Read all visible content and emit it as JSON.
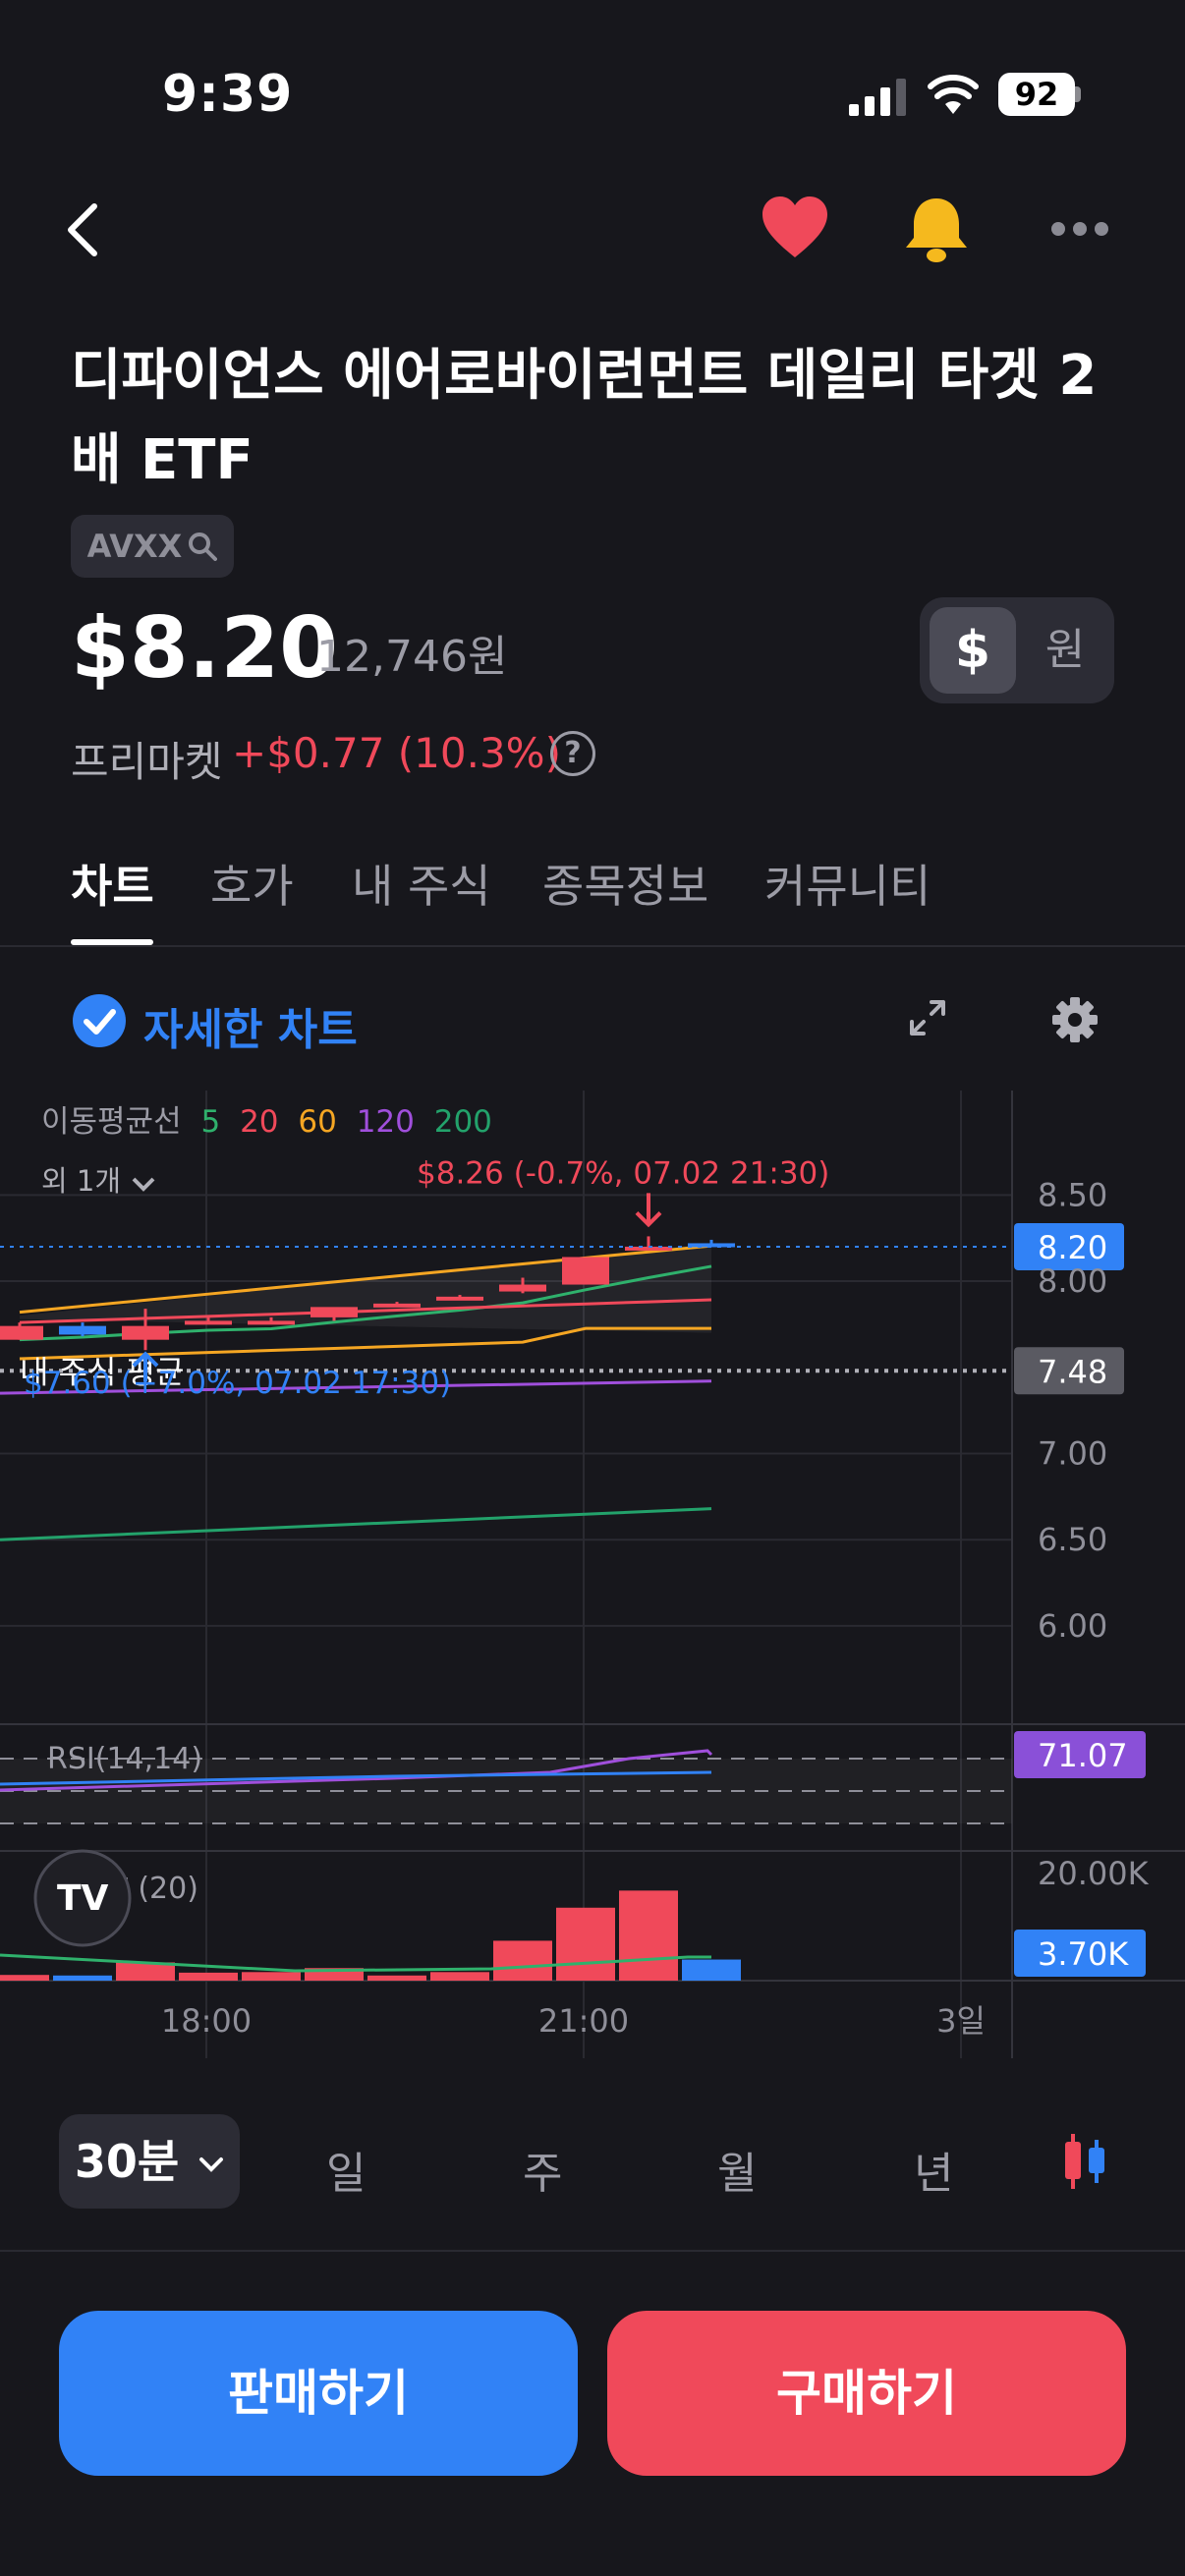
{
  "status": {
    "time": "9:39",
    "battery": "92"
  },
  "stock": {
    "title": "디파이언스 에어로바이런먼트 데일리 타겟 2배 ETF",
    "ticker": "AVXX",
    "price": "$8.20",
    "price_krw": "12,746원",
    "currency_usd": "$",
    "currency_krw": "원",
    "premarket_label": "프리마켓",
    "premarket_change": "+$0.77 (10.3%)",
    "help": "?"
  },
  "tabs": [
    {
      "label": "차트",
      "active": true
    },
    {
      "label": "호가"
    },
    {
      "label": "내 주식"
    },
    {
      "label": "종목정보"
    },
    {
      "label": "커뮤니티"
    }
  ],
  "chart_options": {
    "detail_chart": "자세한 차트"
  },
  "chart_data": {
    "type": "candlestick",
    "interval": "30분",
    "ma_label": "이동평균선",
    "ma_periods": [
      {
        "label": "5",
        "color": "#2fb16c"
      },
      {
        "label": "20",
        "color": "#f0495a"
      },
      {
        "label": "60",
        "color": "#f5a623"
      },
      {
        "label": "120",
        "color": "#a04fdc"
      },
      {
        "label": "200",
        "color": "#23a26b"
      }
    ],
    "more_indicators": "외 1개",
    "y_ticks": [
      "8.50",
      "8.00",
      "7.00",
      "6.50",
      "6.00"
    ],
    "ylim": [
      5.8,
      8.65
    ],
    "x_ticks": [
      "18:00",
      "21:00",
      "3일"
    ],
    "current_price": {
      "value": 8.2,
      "label": "8.20"
    },
    "avg_price": {
      "value": 7.48,
      "label": "7.48",
      "text": "내 주식 평균"
    },
    "high_annotation": {
      "value": 8.26,
      "text": "$8.26 (-0.7%, 07.02 21:30)"
    },
    "low_annotation": {
      "value": 7.6,
      "text": "$7.60 (+7.0%, 07.02 17:30)"
    },
    "candles": [
      {
        "o": 7.74,
        "h": 7.76,
        "l": 7.66,
        "c": 7.66,
        "dir": "down"
      },
      {
        "o": 7.74,
        "h": 7.76,
        "l": 7.68,
        "c": 7.69,
        "dir": "up"
      },
      {
        "o": 7.66,
        "h": 7.84,
        "l": 7.6,
        "c": 7.74,
        "dir": "down"
      },
      {
        "o": 7.77,
        "h": 7.79,
        "l": 7.75,
        "c": 7.77,
        "dir": "down"
      },
      {
        "o": 7.77,
        "h": 7.79,
        "l": 7.75,
        "c": 7.76,
        "dir": "down"
      },
      {
        "o": 7.79,
        "h": 7.8,
        "l": 7.77,
        "c": 7.85,
        "dir": "down"
      },
      {
        "o": 7.86,
        "h": 7.88,
        "l": 7.85,
        "c": 7.87,
        "dir": "down"
      },
      {
        "o": 7.91,
        "h": 7.92,
        "l": 7.9,
        "c": 7.91,
        "dir": "down"
      },
      {
        "o": 7.94,
        "h": 8.02,
        "l": 7.93,
        "c": 7.98,
        "dir": "down"
      },
      {
        "o": 7.98,
        "h": 8.14,
        "l": 7.98,
        "c": 8.14,
        "dir": "down"
      },
      {
        "o": 8.18,
        "h": 8.26,
        "l": 8.18,
        "c": 8.2,
        "dir": "down"
      },
      {
        "o": 8.22,
        "h": 8.24,
        "l": 8.2,
        "c": 8.2,
        "dir": "up"
      }
    ],
    "rsi": {
      "label": "RSI(14,14)",
      "value": "71.07"
    },
    "volume": {
      "label": "거래량 (20)",
      "max_label": "20.00K",
      "current_label": "3.70K",
      "max": 20000,
      "bars": [
        {
          "v": 1000,
          "dir": "down"
        },
        {
          "v": 900,
          "dir": "up"
        },
        {
          "v": 3200,
          "dir": "down"
        },
        {
          "v": 1400,
          "dir": "down"
        },
        {
          "v": 1500,
          "dir": "down"
        },
        {
          "v": 2200,
          "dir": "down"
        },
        {
          "v": 900,
          "dir": "down"
        },
        {
          "v": 1500,
          "dir": "down"
        },
        {
          "v": 7000,
          "dir": "down"
        },
        {
          "v": 12800,
          "dir": "down"
        },
        {
          "v": 15800,
          "dir": "down"
        },
        {
          "v": 3700,
          "dir": "up"
        }
      ]
    }
  },
  "periods": [
    "30분",
    "일",
    "주",
    "월",
    "년"
  ],
  "actions": {
    "sell": "판매하기",
    "buy": "구매하기"
  },
  "colors": {
    "up": "#f0495a",
    "down": "#3182f6",
    "accent": "#3182f6",
    "background": "#17171c"
  }
}
